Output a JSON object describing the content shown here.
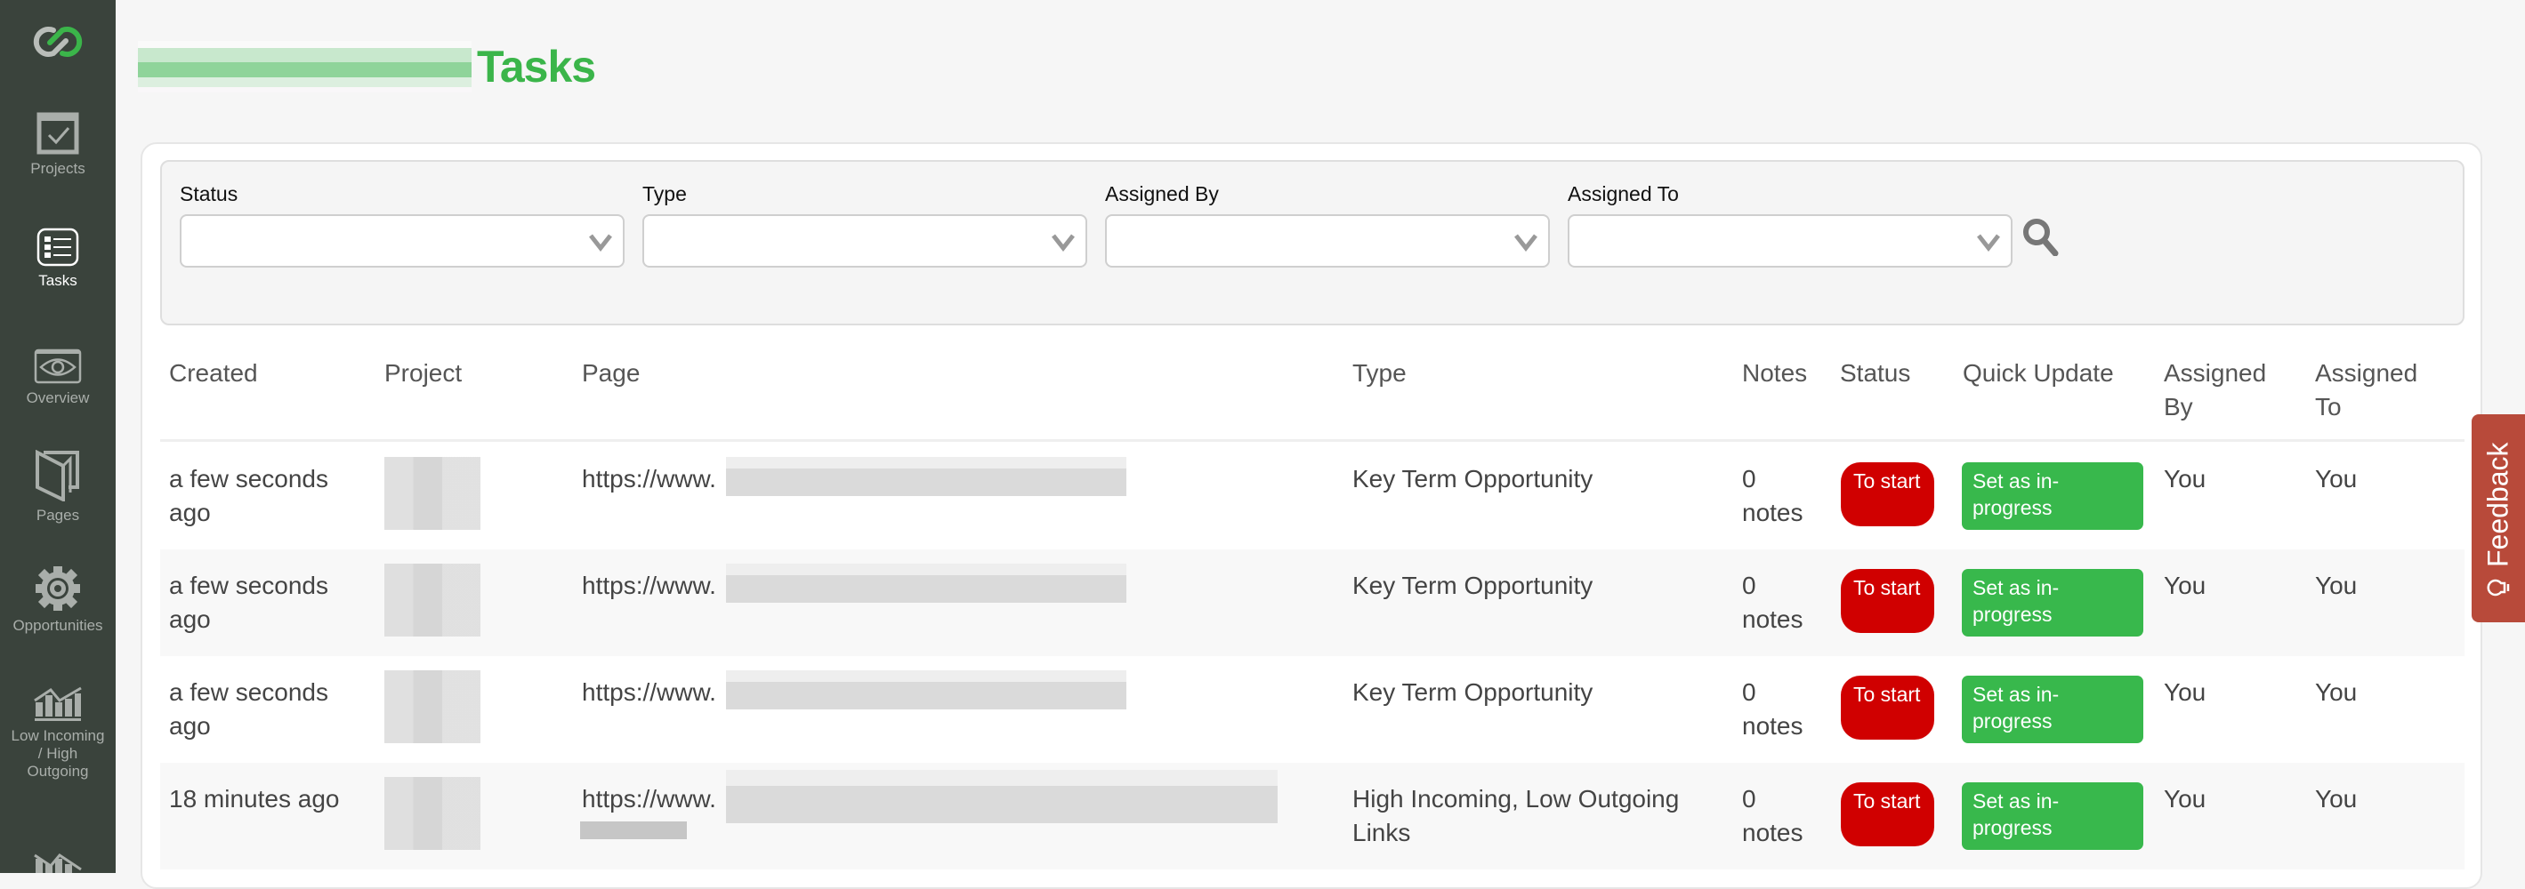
{
  "sidebar": {
    "items": [
      {
        "label": "Projects",
        "icon": "checkbox-icon"
      },
      {
        "label": "Tasks",
        "icon": "list-icon",
        "active": true
      },
      {
        "label": "Overview",
        "icon": "eye-icon"
      },
      {
        "label": "Pages",
        "icon": "pages-icon"
      },
      {
        "label": "Opportunities",
        "icon": "gear-icon"
      },
      {
        "label": "Low Incoming / High Outgoing",
        "icon": "chart-up-icon"
      }
    ]
  },
  "header": {
    "title": "Tasks",
    "accent": "#3bb54a"
  },
  "filters": [
    {
      "label": "Status",
      "value": ""
    },
    {
      "label": "Type",
      "value": ""
    },
    {
      "label": "Assigned By",
      "value": ""
    },
    {
      "label": "Assigned To",
      "value": ""
    }
  ],
  "table": {
    "columns": [
      "Created",
      "Project",
      "Page",
      "Type",
      "Notes",
      "Status",
      "Quick Update",
      "Assigned By",
      "Assigned To"
    ],
    "rows": [
      {
        "created": "a few seconds ago",
        "page": "https://www.",
        "type": "Key Term Opportunity",
        "notes": "0 notes",
        "status": "To start",
        "quick_update": "Set as in-progress",
        "assigned_by": "You",
        "assigned_to": "You"
      },
      {
        "created": "a few seconds ago",
        "page": "https://www.",
        "type": "Key Term Opportunity",
        "notes": "0 notes",
        "status": "To start",
        "quick_update": "Set as in-progress",
        "assigned_by": "You",
        "assigned_to": "You"
      },
      {
        "created": "a few seconds ago",
        "page": "https://www.",
        "type": "Key Term Opportunity",
        "notes": "0 notes",
        "status": "To start",
        "quick_update": "Set as in-progress",
        "assigned_by": "You",
        "assigned_to": "You"
      },
      {
        "created": "18 minutes ago",
        "page": "https://www.",
        "type": "High Incoming, Low Outgoing Links",
        "notes": "0 notes",
        "status": "To start",
        "quick_update": "Set as in-progress",
        "assigned_by": "You",
        "assigned_to": "You"
      }
    ]
  },
  "feedback": {
    "label": "Feedback"
  },
  "colors": {
    "sidebar": "#3a433c",
    "status_red": "#d00000",
    "action_green": "#38b84c",
    "feedback": "#b84a3a"
  }
}
